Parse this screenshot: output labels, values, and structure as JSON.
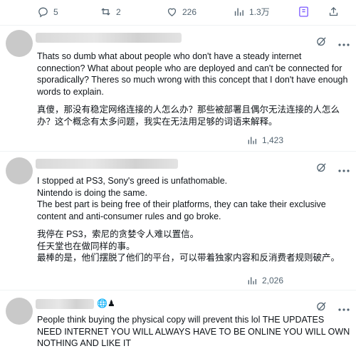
{
  "top_actions": {
    "replies": "5",
    "retweets": "2",
    "likes": "226",
    "views": "1.3万"
  },
  "tweets": [
    {
      "text_en": "Thats so dumb what about people who don't have a steady internet connection? What about people who are deployed and can't be connected for sporadically? Theres so much wrong with this concept that I don't have enough words to explain.",
      "text_zh": "真傻，那没有稳定网络连接的人怎么办？那些被部署且偶尔无法连接的人怎么办？这个概念有太多问题，我实在无法用足够的词语来解释。",
      "views": "1,423"
    },
    {
      "lines_en": [
        "I stopped at PS3, Sony's greed is  unfathomable.",
        "Nintendo is doing the same.",
        "The best part is being free of their platforms, they can take their exclusive content and anti-consumer rules and go broke."
      ],
      "lines_zh": [
        "我停在 PS3，索尼的贪婪令人难以置信。",
        "任天堂也在做同样的事。",
        "最棒的是，他们摆脱了他们的平台，可以带着独家内容和反消费者规则破产。"
      ],
      "views": "2,026"
    },
    {
      "name_icons": "🌐♟",
      "text_en": "People think buying the physical copy will prevent this lol THE UPDATES NEED INTERNET YOU WILL ALWAYS HAVE TO BE ONLINE YOU WILL OWN NOTHING AND LIKE IT"
    }
  ],
  "icons": {
    "reply": "reply-icon",
    "retweet": "retweet-icon",
    "like": "heart-icon",
    "views": "bar-chart-icon",
    "bookmark": "bookmark-icon",
    "share": "share-icon",
    "grok": "grok-icon",
    "more": "more-icon"
  },
  "colors": {
    "icon_gray": "#536471",
    "text": "#0f1419",
    "bookmark_accent": "#7856ff"
  }
}
